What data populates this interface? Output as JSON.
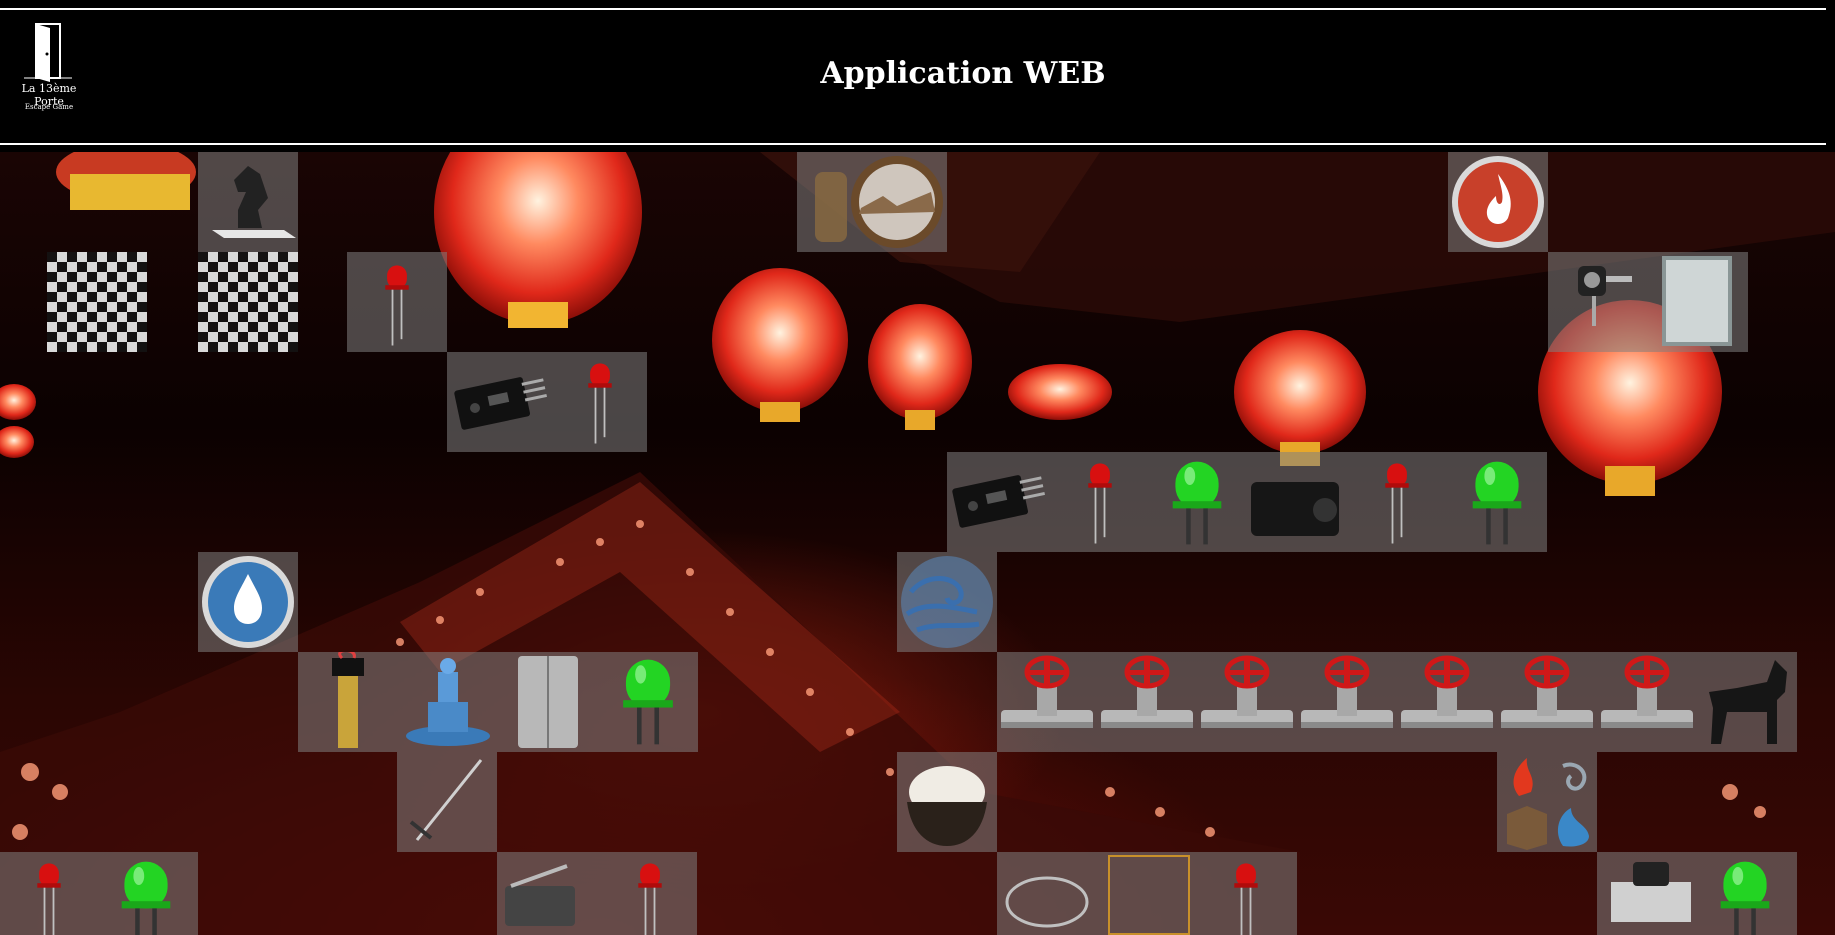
{
  "header": {
    "title": "Application WEB",
    "logo_name": "La 13ème Porte",
    "logo_subtitle": "Escape Game"
  },
  "scene": {
    "background": "chinese-lanterns-temple",
    "accent": "#d92b1a"
  },
  "tiles": [
    {
      "name": "chess-knight-tile",
      "icon": "chess-knight-icon"
    },
    {
      "name": "checkerboard-tile-1",
      "icon": "checkerboard-icon"
    },
    {
      "name": "checkerboard-tile-2",
      "icon": "checkerboard-icon"
    },
    {
      "name": "red-led-tile-1",
      "icon": "red-led-icon"
    },
    {
      "name": "sensor-led-tile",
      "icon": "sensor-module-icon"
    },
    {
      "name": "earth-element-tile",
      "icon": "earth-element-icon"
    },
    {
      "name": "fire-element-tile",
      "icon": "fire-element-icon"
    },
    {
      "name": "key-switch-tile",
      "icon": "key-switch-icon"
    },
    {
      "name": "sensor-leds-fog-tile",
      "icon": "fog-machine-icon"
    },
    {
      "name": "water-element-tile",
      "icon": "water-element-icon"
    },
    {
      "name": "air-element-tile",
      "icon": "air-element-icon"
    },
    {
      "name": "moisture-fountain-fridge-tile",
      "icon": "fridge-icon"
    },
    {
      "name": "valves-dog-tile",
      "icon": "valve-icon"
    },
    {
      "name": "sword-tile",
      "icon": "sword-icon"
    },
    {
      "name": "rice-bowl-tile",
      "icon": "rice-bowl-icon"
    },
    {
      "name": "four-elements-tile",
      "icon": "elements-icon"
    },
    {
      "name": "leds-bottom-left-tile",
      "icon": "green-led-icon"
    },
    {
      "name": "microswitch-led-tile",
      "icon": "microswitch-icon"
    },
    {
      "name": "bowl-led-tile",
      "icon": "red-led-icon"
    },
    {
      "name": "pushbutton-led-tile",
      "icon": "pushbutton-icon"
    }
  ]
}
